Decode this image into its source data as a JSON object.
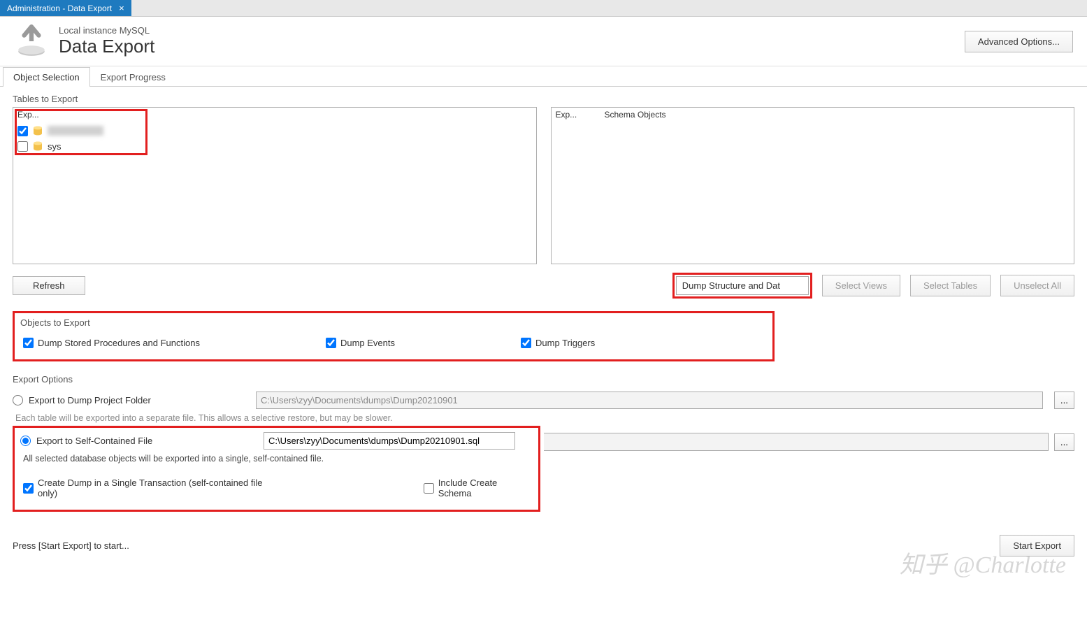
{
  "window": {
    "tab_title": "Administration - Data Export"
  },
  "header": {
    "subtitle": "Local instance MySQL",
    "title": "Data Export",
    "advanced_btn": "Advanced Options..."
  },
  "tabs": {
    "object_selection": "Object Selection",
    "export_progress": "Export Progress"
  },
  "tables_section": {
    "label": "Tables to Export",
    "left_header_exp": "Exp...",
    "right_header_exp": "Exp...",
    "right_header_objs": "Schema Objects",
    "schema_sys": "sys",
    "refresh_btn": "Refresh",
    "dump_select": "Dump Structure and Dat",
    "select_views_btn": "Select Views",
    "select_tables_btn": "Select Tables",
    "unselect_all_btn": "Unselect All"
  },
  "objects_section": {
    "label": "Objects to Export",
    "dump_procs": "Dump Stored Procedures and Functions",
    "dump_events": "Dump Events",
    "dump_triggers": "Dump Triggers"
  },
  "export_options": {
    "label": "Export Options",
    "radio_folder": "Export to Dump Project Folder",
    "folder_path": "C:\\Users\\zyy\\Documents\\dumps\\Dump20210901",
    "folder_help": "Each table will be exported into a separate file. This allows a selective restore, but may be slower.",
    "radio_file": "Export to Self-Contained File",
    "file_path": "C:\\Users\\zyy\\Documents\\dumps\\Dump20210901.sql",
    "file_help": "All selected database objects will be exported into a single, self-contained file.",
    "single_tx": "Create Dump in a Single Transaction (self-contained file only)",
    "include_schema": "Include Create Schema",
    "browse": "..."
  },
  "footer": {
    "status": "Press [Start Export] to start...",
    "start_btn": "Start Export"
  },
  "watermark": "知乎 @Charlotte"
}
